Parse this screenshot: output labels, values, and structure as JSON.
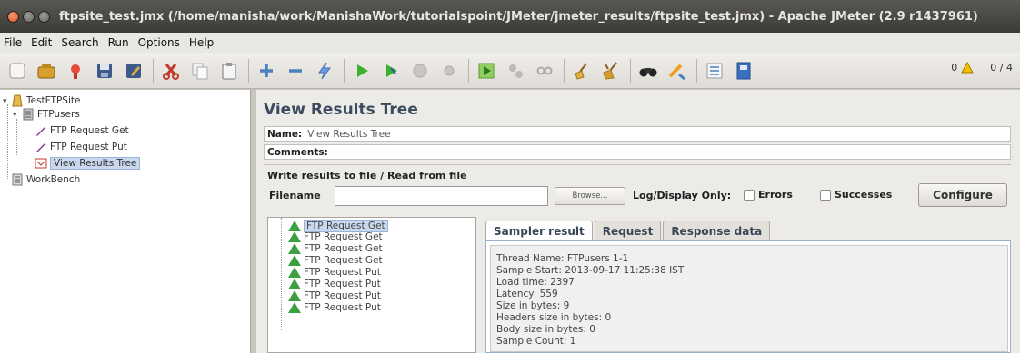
{
  "window": {
    "title": "ftpsite_test.jmx (/home/manisha/work/ManishaWork/tutorialspoint/JMeter/jmeter_results/ftpsite_test.jmx) - Apache JMeter (2.9 r1437961)"
  },
  "menu": {
    "items": [
      {
        "label": "File"
      },
      {
        "label": "Edit"
      },
      {
        "label": "Search"
      },
      {
        "label": "Run"
      },
      {
        "label": "Options"
      },
      {
        "label": "Help"
      }
    ]
  },
  "toolbar": {
    "status_errors": "0",
    "status_threads": "0 / 4"
  },
  "tree": {
    "root": "TestFTPSite",
    "thread_group": "FTPusers",
    "children": [
      "FTP Request Get",
      "FTP Request Put",
      "View Results Tree"
    ],
    "workbench": "WorkBench",
    "selected": "View Results Tree"
  },
  "panel": {
    "title": "View Results Tree",
    "name_label": "Name:",
    "name_value": "View Results Tree",
    "comments_label": "Comments:",
    "file_group_label": "Write results to file / Read from file",
    "filename_label": "Filename",
    "filename_value": "",
    "browse_label": "Browse...",
    "logdisplay_label": "Log/Display Only:",
    "errors_label": "Errors",
    "successes_label": "Successes",
    "configure_label": "Configure"
  },
  "samples": [
    "FTP Request Get",
    "FTP Request Get",
    "FTP Request Get",
    "FTP Request Get",
    "FTP Request Put",
    "FTP Request Put",
    "FTP Request Put",
    "FTP Request Put"
  ],
  "tabs": [
    "Sampler result",
    "Request",
    "Response data"
  ],
  "result_lines": [
    "Thread Name: FTPusers 1-1",
    "Sample Start: 2013-09-17 11:25:38 IST",
    "Load time: 2397",
    "Latency: 559",
    "Size in bytes: 9",
    "Headers size in bytes: 0",
    "Body size in bytes: 0",
    "Sample Count: 1"
  ]
}
